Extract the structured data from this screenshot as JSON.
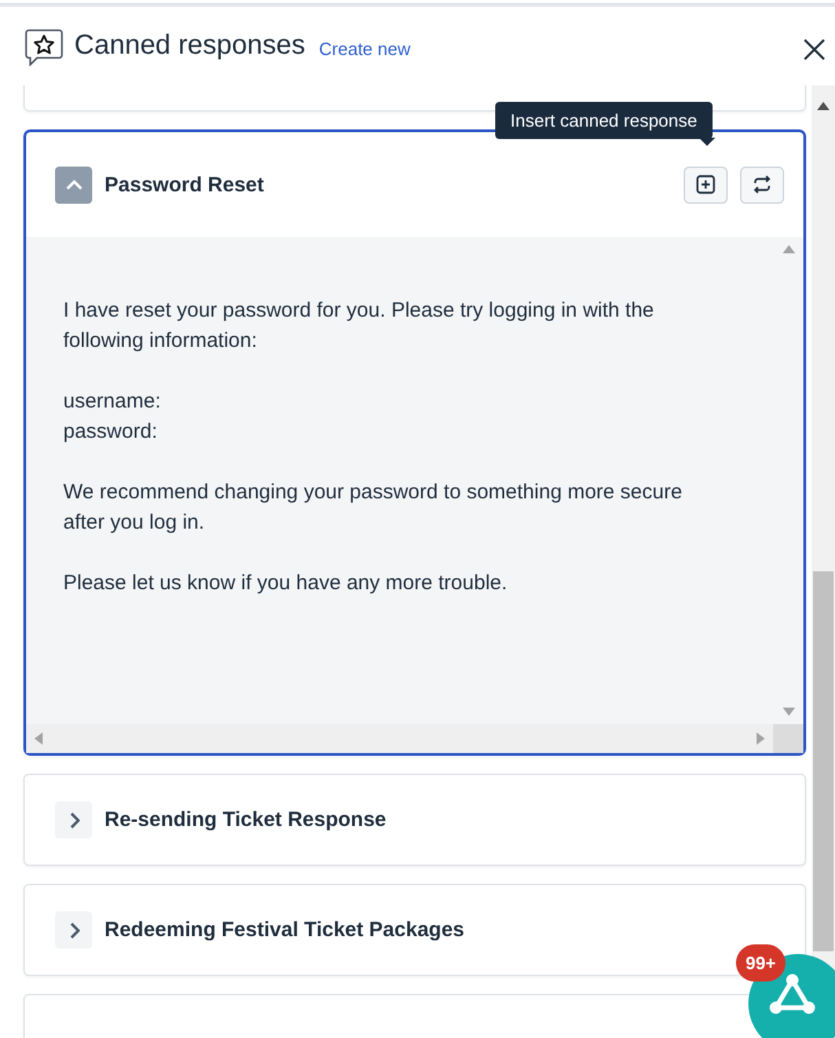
{
  "panel": {
    "title": "Canned responses",
    "create_link": "Create new"
  },
  "tooltip": "Insert canned response",
  "responses": [
    {
      "title": "Password Reset",
      "expanded": true,
      "body": "I have reset your password for you. Please try logging in with the following information:\n\nusername:\npassword:\n\nWe recommend changing your password to something more secure after you log in.\n\nPlease let us know if you have any more trouble."
    },
    {
      "title": "Re-sending Ticket Response",
      "expanded": false
    },
    {
      "title": "Redeeming Festival Ticket Packages",
      "expanded": false
    }
  ],
  "notification_badge": "99+"
}
